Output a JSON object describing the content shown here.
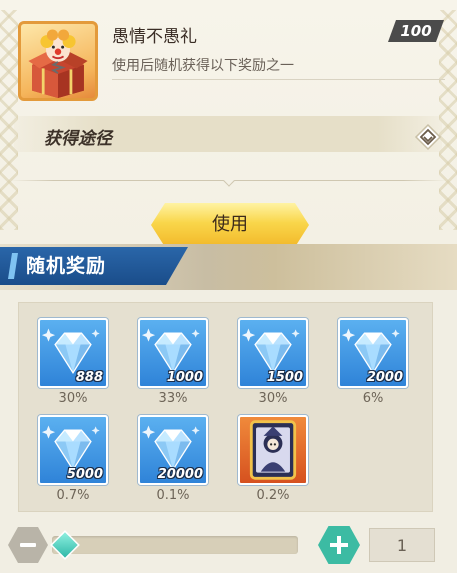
{
  "item": {
    "name": "愚情不愚礼",
    "count": "100",
    "description": "使用后随机获得以下奖励之一",
    "icon": "clown-gift-box-icon"
  },
  "source": {
    "label": "获得途径",
    "icon": "expand-diamond-icon"
  },
  "actions": {
    "use_label": "使用"
  },
  "rewards": {
    "title": "随机奖励",
    "items": [
      {
        "quantity": "888",
        "rate": "30%",
        "icon": "diamond-icon"
      },
      {
        "quantity": "1000",
        "rate": "33%",
        "icon": "diamond-icon"
      },
      {
        "quantity": "1500",
        "rate": "30%",
        "icon": "diamond-icon"
      },
      {
        "quantity": "2000",
        "rate": "6%",
        "icon": "diamond-icon"
      },
      {
        "quantity": "5000",
        "rate": "0.7%",
        "icon": "diamond-icon"
      },
      {
        "quantity": "20000",
        "rate": "0.1%",
        "icon": "diamond-icon"
      },
      {
        "quantity": "",
        "rate": "0.2%",
        "icon": "character-card-icon"
      }
    ]
  },
  "quantity": {
    "value": "1",
    "minus_icon": "minus-icon",
    "plus_icon": "plus-icon",
    "slider_level": 0
  },
  "colors": {
    "accent_yellow": "#f9d64a",
    "header_blue": "#1a4d8a",
    "plus_teal": "#3cbba3",
    "panel_bg": "#f1eee3"
  }
}
